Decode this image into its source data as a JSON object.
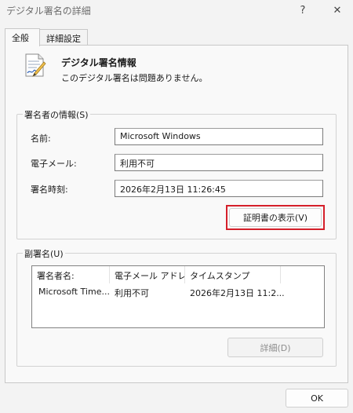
{
  "window": {
    "title": "デジタル署名の詳細",
    "help_glyph": "?",
    "close_glyph": "✕"
  },
  "tabs": [
    {
      "label": "全般",
      "active": true
    },
    {
      "label": "詳細設定",
      "active": false
    }
  ],
  "header": {
    "title": "デジタル署名情報",
    "status": "このデジタル署名は問題ありません。",
    "icon": "signed-document-icon"
  },
  "signer": {
    "group_label": "署名者の情報(S)",
    "name_label": "名前:",
    "name_value": "Microsoft Windows",
    "email_label": "電子メール:",
    "email_value": "利用不可",
    "time_label": "署名時刻:",
    "time_value": "2026年2月13日 11:26:45",
    "view_cert_label": "証明書の表示(V)"
  },
  "countersign": {
    "group_label": "副署名(U)",
    "columns": [
      "署名者名:",
      "電子メール アドレ...",
      "タイムスタンプ"
    ],
    "rows": [
      [
        "Microsoft Time...",
        "利用不可",
        "2026年2月13日 11:2..."
      ]
    ],
    "details_label": "詳細(D)"
  },
  "ok_label": "OK",
  "colors": {
    "highlight": "#d51f2a",
    "background": "#f3f3f3"
  }
}
